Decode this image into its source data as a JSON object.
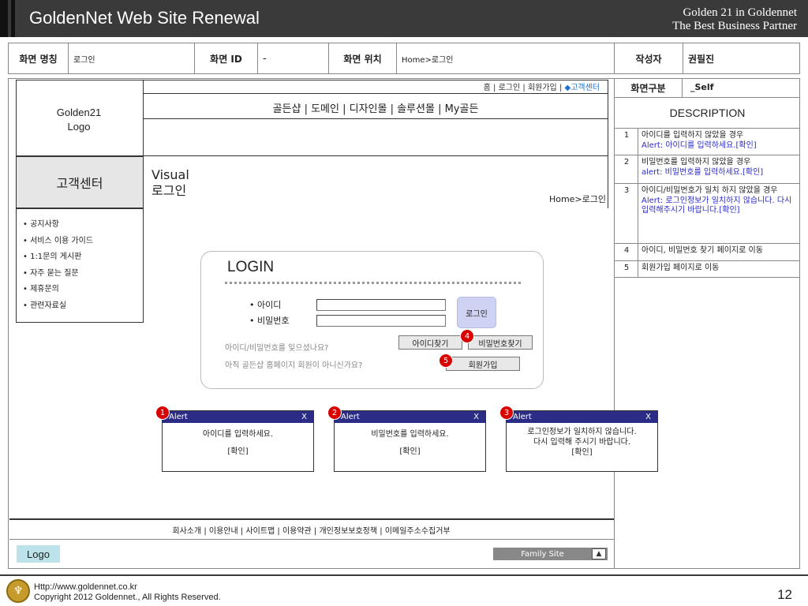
{
  "header": {
    "title": "GoldenNet Web Site Renewal",
    "tagline1": "Golden 21 in Goldennet",
    "tagline2": "The Best Business Partner",
    "bg_color": "#3a3a3a"
  },
  "info": {
    "screen_name_label": "화면 명칭",
    "screen_name": "로그인",
    "screen_id_label": "화면 ID",
    "screen_id": "-",
    "screen_loc_label": "화면 위치",
    "screen_loc": "Home>로그인",
    "author_label": "작성자",
    "author": "권필진",
    "screen_type_label": "화면구분",
    "screen_type": "_Self"
  },
  "site": {
    "topnav": [
      "홈",
      "로그인",
      "회원가입"
    ],
    "topnav_highlight": "◆고객센터",
    "gnb": "골든샵 | 도메인 | 디자인몰 | 솔루션몰 | My골든",
    "logo_line1": "Golden21",
    "logo_line2": "Logo",
    "section": "고객센터",
    "visual_line1": "Visual",
    "visual_line2": "로그인",
    "visual_location": "Home>로그인",
    "sidemenu": [
      "• 공지사항",
      "• 서비스 이용 가이드",
      "• 1:1문의 게시판",
      "• 자주 묻는 질문",
      "• 제휴문의",
      "• 관련자료실"
    ]
  },
  "login": {
    "title": "LOGIN",
    "id_label": "• 아이디",
    "pw_label": "• 비밀번호",
    "id_value": "",
    "pw_value": "",
    "login_button": "로그인",
    "forgot_text": "아이디/비밀번호를 잊으셨나요?",
    "find_id_button": "아이디찾기",
    "find_pw_button": "비밀번호찾기",
    "not_member_text": "아직 골든샵 홈페이지 회원이 아니신가요?",
    "join_button": "회원가입",
    "badge4": "4",
    "badge5": "5"
  },
  "alerts": [
    {
      "badge": "1",
      "title": "Alert",
      "close": "X",
      "line1": "아이디를 입력하세요.",
      "line2": "",
      "ok": "[확인]"
    },
    {
      "badge": "2",
      "title": "Alert",
      "close": "X",
      "line1": "비밀번호를 입력하세요.",
      "line2": "",
      "ok": "[확인]"
    },
    {
      "badge": "3",
      "title": "Alert",
      "close": "X",
      "line1": "로그인정보가 일치하지 않습니다.",
      "line2": "다시 입력해 주시기 바랍니다.",
      "ok": "[확인]"
    }
  ],
  "footer": {
    "links": "회사소개 | 이용안내 | 사이트맵 | 이용약관 | 개인정보보호정책 | 이메일주소수집거부",
    "logo": "Logo",
    "family_site": "Family Site",
    "family_arrow": "▲"
  },
  "description": {
    "title": "DESCRIPTION",
    "items": [
      {
        "n": "1",
        "text": "아이디를 입력하지 않았을 경우",
        "alert": "Alert: 아이디를 입력하세요.[확인]"
      },
      {
        "n": "2",
        "text": "비밀번호를 입력하지 않았을 경우",
        "alert": "alert: 비밀번호를 입력하세요.[확인]"
      },
      {
        "n": "3",
        "text": "아이디/비밀번호가 일치 하지 않았을 경우",
        "alert": "Alert: 로그인정보가 일치하지 않습니다. 다시 입력해주시기 바랍니다.[확인]"
      },
      {
        "n": "4",
        "text": "아이디, 비밀번호 찾기 페이지로 이동",
        "alert": ""
      },
      {
        "n": "5",
        "text": "회원가입 페이지로 이동",
        "alert": ""
      }
    ]
  },
  "bottom": {
    "url": "Http://www.goldennet.co.kr",
    "copyright": "Copyright 2012 Goldennet., All Rights Reserved.",
    "page": "12"
  }
}
